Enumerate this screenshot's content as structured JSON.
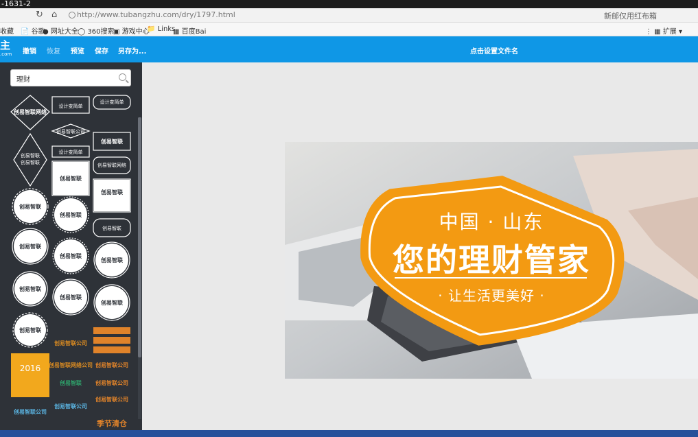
{
  "window": {
    "title": "-1631-2"
  },
  "address_bar": {
    "url": "http://www.tubangzhu.com/dry/1797.html",
    "right_text": "新邮仅用红布箱"
  },
  "bookmarks": {
    "items": [
      "收藏",
      "谷歌",
      "网址大全",
      "360搜索",
      "游戏中心",
      "Links",
      "百度Bai"
    ],
    "right": [
      "扩展"
    ]
  },
  "toolbar": {
    "logo": "主",
    "logo_sub": ".com",
    "undo_label": "撤销",
    "redo_label": "恢复",
    "preview_label": "预览",
    "save_label": "保存",
    "save_as_label": "另存为...",
    "filename_label": "点击设置文件名"
  },
  "sidebar": {
    "search_value": "理财",
    "thumb_labels": [
      "创易智联网络",
      "设计变简单",
      "创易智联",
      "创易智联网络",
      "2016"
    ]
  },
  "canvas": {
    "badge_top": "中国 · 山东",
    "badge_main": "您的理财管家",
    "badge_sub": "· 让生活更美好 ·"
  },
  "colors": {
    "toolbar": "#0f97e6",
    "badge": "#f39a12",
    "sidebar": "#2e3238"
  }
}
